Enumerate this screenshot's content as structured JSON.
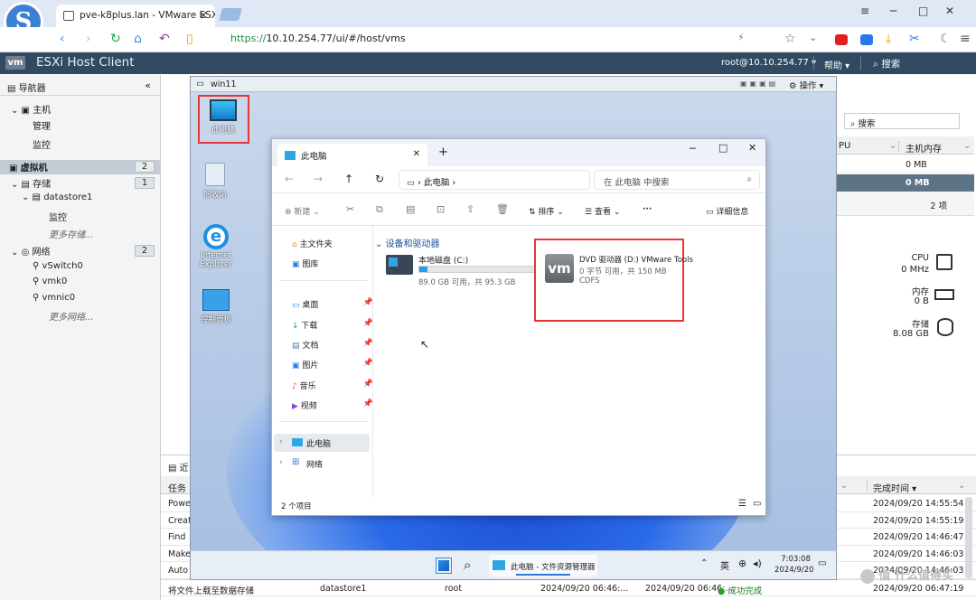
{
  "browser": {
    "logo_letter": "S",
    "tab_title": "pve-k8plus.lan - VMware ESXi",
    "url_scheme": "https://",
    "url_rest": "10.10.254.77/ui/#/host/vms",
    "minimize": "─",
    "restore": "□",
    "close": "✕",
    "menu": "≡"
  },
  "esxi": {
    "logo": "vm",
    "title": "ESXi Host Client",
    "user": "root@10.10.254.77 ▾",
    "help": "帮助 ▾",
    "search": "搜索"
  },
  "navigator": {
    "title": "导航器",
    "host": "主机",
    "manage": "管理",
    "monitor": "监控",
    "vms": "虚拟机",
    "vms_count": "2",
    "storage": "存储",
    "storage_count": "1",
    "datastore": "datastore1",
    "ds_monitor": "监控",
    "more_storage": "更多存储...",
    "network": "网络",
    "network_count": "2",
    "vswitch": "vSwitch0",
    "vmk": "vmk0",
    "vmnic": "vmnic0",
    "more_network": "更多网络..."
  },
  "vmlist": {
    "search": "搜索",
    "col_cpu": "PU",
    "col_mem": "主机内存",
    "row1_mem": "0 MB",
    "row2_mem": "0 MB",
    "count": "2 项"
  },
  "resources": {
    "cpu_label": "CPU",
    "cpu_value": "0 MHz",
    "mem_label": "内存",
    "mem_value": "0 B",
    "storage_label": "存储",
    "storage_value": "8.08 GB"
  },
  "tasks": {
    "panel_title": "近",
    "col_task": "任务",
    "col_done": "完成时间 ▾",
    "rows": [
      {
        "task": "Powe",
        "done": "2024/09/20 14:55:54"
      },
      {
        "task": "Creat",
        "done": "2024/09/20 14:55:19"
      },
      {
        "task": "Find",
        "done": "2024/09/20 14:46:47"
      },
      {
        "task": "Make",
        "done": "2024/09/20 14:46:03"
      },
      {
        "task": "Auto",
        "done": "2024/09/20 14:46:03"
      }
    ],
    "last_task": "将文件上载至数据存储",
    "last_target": "datastore1",
    "last_user": "root",
    "last_start": "2024/09/20 06:46:...",
    "last_queued": "2024/09/20 06:46:...",
    "last_result": "成功完成",
    "last_done": "2024/09/20 06:47:19"
  },
  "console": {
    "title": "win11",
    "actions": "⚙ 操作 ▾",
    "desktop_icons": [
      "此电脑",
      "回收站",
      "Internet Explorer",
      "控制面板"
    ],
    "taskbar_app": "此电脑 - 文件资源管理器",
    "tray_lang": "英",
    "clock_time": "7:03:08",
    "clock_date": "2024/9/20"
  },
  "explorer": {
    "tab_title": "此电脑",
    "new_tab": "+",
    "crumb": "此电脑",
    "search_placeholder": "在 此电脑 中搜索",
    "tb_new": "新建",
    "tb_sort": "排序",
    "tb_view": "查看",
    "tb_more": "···",
    "tb_details": "详细信息",
    "side": [
      "主文件夹",
      "图库",
      "桌面",
      "下载",
      "文档",
      "图片",
      "音乐",
      "视频",
      "此电脑",
      "网络"
    ],
    "group_title": "设备和驱动器",
    "drive_c_name": "本地磁盘 (C:)",
    "drive_c_info": "89.0 GB 可用，共 95.3 GB",
    "drive_c_fill": 0.07,
    "drive_d_name": "DVD 驱动器 (D:) VMware Tools",
    "drive_d_info": "0 字节 可用，共 150 MB",
    "drive_d_fs": "CDFS",
    "status": "2 个项目"
  },
  "watermark": "值 什么值得买",
  "colors": {
    "accent": "#2f4a61",
    "highlight": "#e83535",
    "selection": "#c3ccd4"
  }
}
